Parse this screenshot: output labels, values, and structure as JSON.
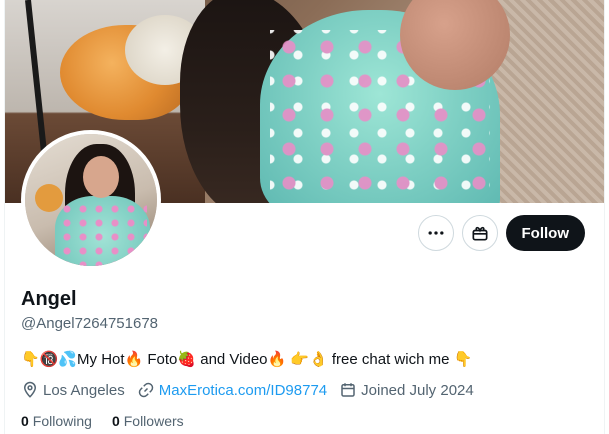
{
  "profile": {
    "name": "Angel",
    "handle": "@Angel7264751678",
    "bio": "👇🔞💦My Hot🔥 Foto🍓 and Video🔥 👉👌 free chat wich me 👇",
    "location": "Los Angeles",
    "website": "MaxErotica.com/ID98774",
    "joined": "Joined July 2024"
  },
  "actions": {
    "more_icon": "more-horizontal-icon",
    "subscribe_icon": "gift-icon",
    "follow_label": "Follow"
  },
  "stats": {
    "following_count": "0",
    "following_label": "Following",
    "followers_count": "0",
    "followers_label": "Followers"
  },
  "colors": {
    "accent": "#1d9bf0",
    "primary_text": "#0f1419",
    "secondary_text": "#536471",
    "follow_bg": "#0f1419"
  }
}
